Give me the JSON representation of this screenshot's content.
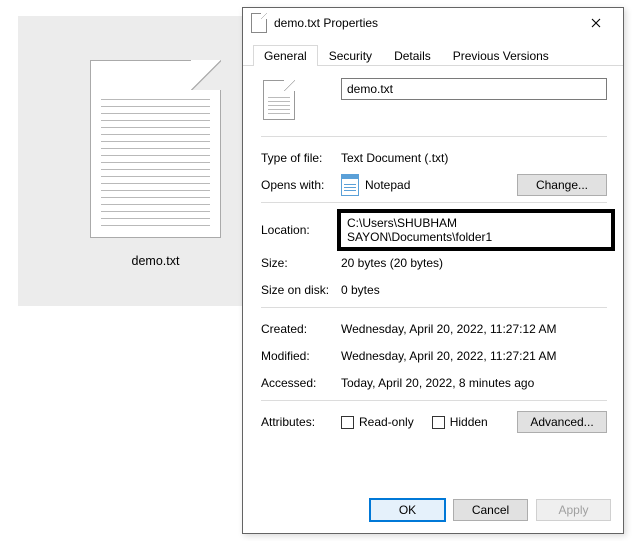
{
  "desktop": {
    "file_label": "demo.txt"
  },
  "dialog": {
    "title": "demo.txt Properties",
    "tabs": {
      "general": "General",
      "security": "Security",
      "details": "Details",
      "previous": "Previous Versions"
    },
    "filename": "demo.txt",
    "labels": {
      "type_of_file": "Type of file:",
      "opens_with": "Opens with:",
      "location": "Location:",
      "size": "Size:",
      "size_on_disk": "Size on disk:",
      "created": "Created:",
      "modified": "Modified:",
      "accessed": "Accessed:",
      "attributes": "Attributes:"
    },
    "values": {
      "type_of_file": "Text Document (.txt)",
      "opens_with_app": "Notepad",
      "location": "C:\\Users\\SHUBHAM SAYON\\Documents\\folder1",
      "size": "20 bytes (20 bytes)",
      "size_on_disk": "0 bytes",
      "created": "Wednesday, April 20, 2022, 11:27:12 AM",
      "modified": "Wednesday, April 20, 2022, 11:27:21 AM",
      "accessed": "Today, April 20, 2022, 8 minutes ago"
    },
    "buttons": {
      "change": "Change...",
      "advanced": "Advanced...",
      "ok": "OK",
      "cancel": "Cancel",
      "apply": "Apply"
    },
    "checkboxes": {
      "readonly": "Read-only",
      "hidden": "Hidden"
    }
  }
}
